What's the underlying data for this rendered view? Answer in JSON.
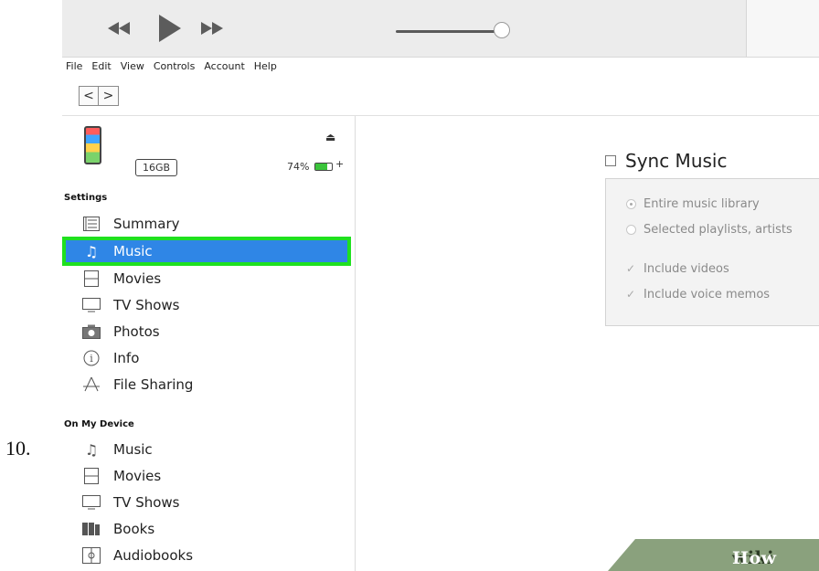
{
  "step_number": "10.",
  "menu": [
    "File",
    "Edit",
    "View",
    "Controls",
    "Account",
    "Help"
  ],
  "nav": {
    "back": "<",
    "forward": ">"
  },
  "device": {
    "capacity": "16GB",
    "battery_text": "74%",
    "battery_level": 0.74,
    "battery_plus": "+"
  },
  "sidebar": {
    "settings_header": "Settings",
    "settings_items": [
      {
        "label": "Summary",
        "icon": "summary-icon"
      },
      {
        "label": "Music",
        "icon": "music-note-icon",
        "selected": true
      },
      {
        "label": "Movies",
        "icon": "film-icon"
      },
      {
        "label": "TV Shows",
        "icon": "tv-icon"
      },
      {
        "label": "Photos",
        "icon": "camera-icon"
      },
      {
        "label": "Info",
        "icon": "info-icon"
      },
      {
        "label": "File Sharing",
        "icon": "file-sharing-icon"
      }
    ],
    "device_header": "On My Device",
    "device_items": [
      {
        "label": "Music",
        "icon": "music-note-icon"
      },
      {
        "label": "Movies",
        "icon": "film-icon"
      },
      {
        "label": "TV Shows",
        "icon": "tv-icon"
      },
      {
        "label": "Books",
        "icon": "books-icon"
      },
      {
        "label": "Audiobooks",
        "icon": "audiobooks-icon"
      }
    ]
  },
  "sync": {
    "title": "Sync Music",
    "options": [
      {
        "label": "Entire music library",
        "type": "radio",
        "checked": true
      },
      {
        "label": "Selected playlists, artists",
        "type": "radio",
        "checked": false
      },
      {
        "label": "Include videos",
        "type": "checkbox",
        "checked": true
      },
      {
        "label": "Include voice memos",
        "type": "checkbox",
        "checked": true
      }
    ]
  },
  "watermark": {
    "part1": "wiki",
    "part2": "How"
  },
  "colors": {
    "selection": "#2f86e6",
    "highlight_box": "#1fe01f",
    "watermark_bg": "#8aa17d"
  }
}
